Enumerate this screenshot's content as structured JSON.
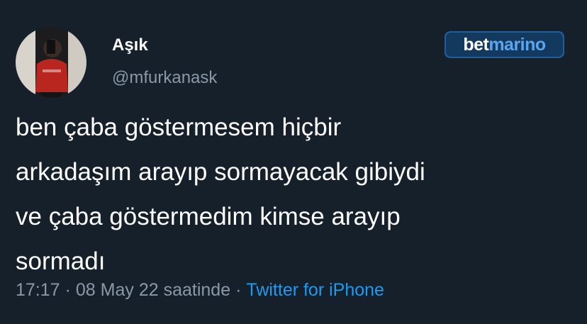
{
  "user": {
    "display_name": "Aşık",
    "handle": "@mfurkanask"
  },
  "brand": {
    "part1": "bet",
    "part2": "marino"
  },
  "tweet": {
    "lines": [
      "ben çaba göstermesem hiçbir",
      "arkadaşım arayıp sormayacak gibiydi",
      "ve çaba göstermedim kimse arayıp",
      "sormadı"
    ]
  },
  "meta": {
    "time": "17:17",
    "separator": "·",
    "date": "08 May 22 saatinde",
    "source": "Twitter for iPhone"
  },
  "colors": {
    "background": "#15202b",
    "text": "#ffffff",
    "muted": "#8b98a5",
    "link": "#1d9bf0",
    "brand_bg": "#14395f",
    "brand_accent": "#5aa6ee"
  }
}
